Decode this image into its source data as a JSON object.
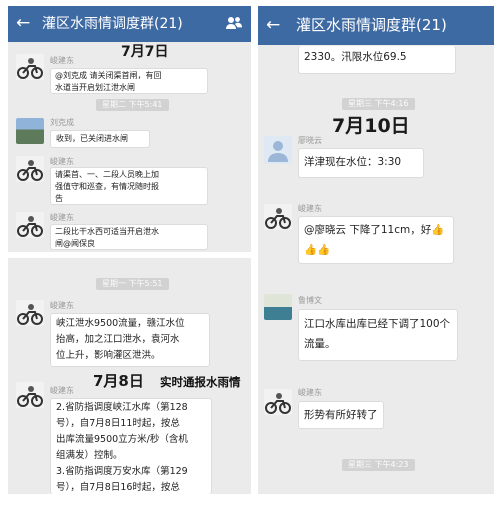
{
  "left_top": {
    "title": "灌区水雨情调度群(21)",
    "date_overlay": "7月7日",
    "sender_1": "峻建东",
    "message_1": "@刘克成 请关闭渠首闸，有回\n水道当开启划江泄水闸",
    "time_2": "星期二 下午5:41",
    "sender_2": "刘克成",
    "message_2": "收到，已关闭进水闸",
    "sender_3": "峻建东",
    "message_3": "请渠首、一、二段人员晚上加\n强值守和巡查，有情况随时报\n告",
    "sender_4": "峻建东",
    "message_4": "二段比干水西可适当开启泄水\n闸@闻保良"
  },
  "left_bottom": {
    "time_1": "星期一 下午5:51",
    "sender_1": "峻建东",
    "message_1": "峡江泄水9500流量，赣江水位\n抬高，加之江口泄水，袁河水\n位上升，影响灌区泄洪。",
    "date_overlay": "7月8日",
    "annotation": "实时通报水雨情",
    "sender_2": "峻建东",
    "message_2": "2.省防指调度峡江水库（第128\n号），自7月8日11时起，按总\n出库流量9500立方米/秒（含机\n组满发）控制。\n3.省防指调度万安水库（第129\n号），自7月8日16时起，按总"
  },
  "right": {
    "title": "灌区水雨情调度群(21)",
    "message_0": "2330。汛限水位69.5",
    "time_1": "星期三 下午4:16",
    "date_overlay": "7月10日",
    "sender_1": "廖晓云",
    "message_1": "洋津现在水位：3:30米。",
    "sender_2": "峻建东",
    "message_2": "@廖晓云 下降了11cm，好👍\n👍👍",
    "sender_3": "鲁博文",
    "message_3": "江口水库出库已经下调了100个\n流量。",
    "sender_4": "峻建东",
    "message_4": "形势有所好转了",
    "time_2": "星期三 下午4:23"
  },
  "icons": {
    "back": "←",
    "group": "group-members-icon"
  },
  "colors": {
    "topbar": "#3e6aa4",
    "chat_bg": "#ebebeb",
    "bubble": "#ffffff"
  }
}
